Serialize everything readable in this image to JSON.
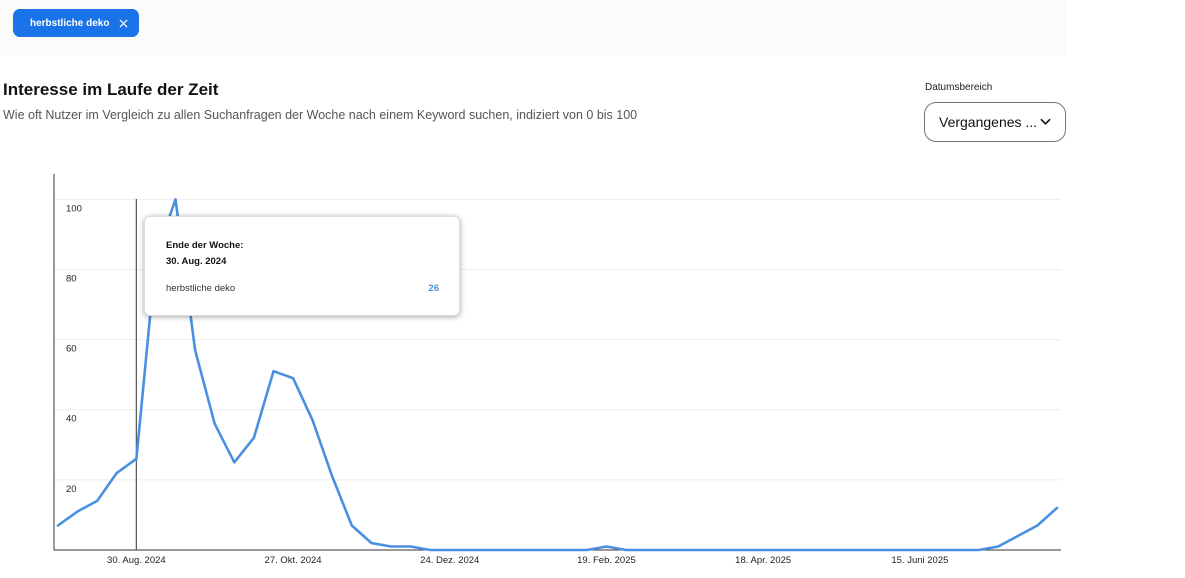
{
  "filter": {
    "chip_label": "herbstliche deko",
    "close_icon": "close-icon"
  },
  "header": {
    "title": "Interesse im Laufe der Zeit",
    "subtitle": "Wie oft Nutzer im Vergleich zu allen Suchanfragen der Woche nach einem Keyword suchen, indiziert von 0 bis 100"
  },
  "date_range": {
    "label": "Datumsbereich",
    "value": "Vergangenes ...",
    "icon": "chevron-down-icon"
  },
  "tooltip": {
    "heading": "Ende der Woche:",
    "date": "30. Aug. 2024",
    "series_name": "herbstliche deko",
    "value": "26"
  },
  "colors": {
    "accent": "#1a73e8",
    "line": "#4a90e2",
    "grid": "#eeeeee",
    "axis": "#333333"
  },
  "chart_data": {
    "type": "line",
    "title": "",
    "xlabel": "",
    "ylabel": "",
    "ylim": [
      0,
      105
    ],
    "yticks": [
      20,
      40,
      60,
      80,
      100
    ],
    "grid": true,
    "xtick_labels": [
      "30. Aug. 2024",
      "27. Okt. 2024",
      "24. Dez. 2024",
      "19. Feb. 2025",
      "18. Apr. 2025",
      "15. Juni 2025"
    ],
    "xtick_weeks": [
      4,
      12,
      20,
      28,
      36,
      44
    ],
    "hover_week": 4,
    "series": [
      {
        "name": "herbstliche deko",
        "values": [
          7,
          11,
          14,
          22,
          26,
          84,
          100,
          57,
          36,
          25,
          32,
          51,
          49,
          37,
          21,
          7,
          2,
          1,
          1,
          0,
          0,
          0,
          0,
          0,
          0,
          0,
          0,
          0,
          1,
          0,
          0,
          0,
          0,
          0,
          0,
          0,
          0,
          0,
          0,
          0,
          0,
          0,
          0,
          0,
          0,
          0,
          0,
          0,
          1,
          4,
          7,
          12
        ]
      }
    ]
  }
}
